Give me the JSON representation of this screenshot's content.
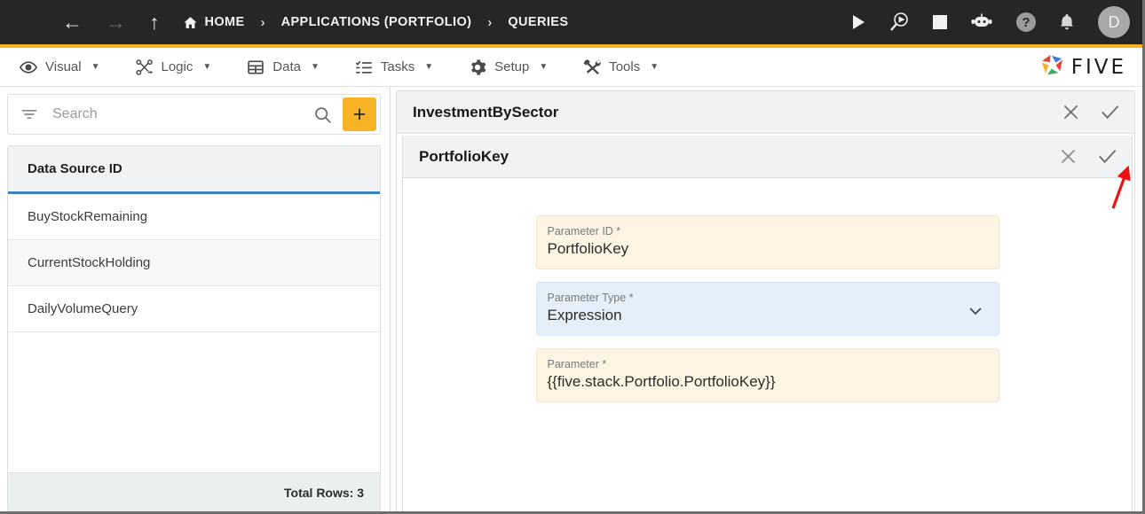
{
  "topbar": {
    "menu_icon": "hamburger-icon",
    "back_icon": "arrow-left-icon",
    "forward_icon": "arrow-right-icon",
    "up_icon": "arrow-up-icon",
    "breadcrumbs": [
      {
        "label": "HOME",
        "icon": "home-icon"
      },
      {
        "label": "APPLICATIONS (PORTFOLIO)",
        "icon": ""
      },
      {
        "label": "QUERIES",
        "icon": ""
      }
    ],
    "separator": "›",
    "actions": [
      {
        "name": "run-icon",
        "title": "Run"
      },
      {
        "name": "debug-icon",
        "title": "Debug"
      },
      {
        "name": "stop-icon",
        "title": "Stop"
      },
      {
        "name": "chatbot-icon",
        "title": "Assistant"
      },
      {
        "name": "help-icon",
        "title": "Help",
        "glyph": "?"
      },
      {
        "name": "notifications-bell-icon",
        "title": "Notifications"
      }
    ],
    "avatar_initial": "D"
  },
  "menubar": {
    "items": [
      {
        "label": "Visual",
        "icon": "eye-icon"
      },
      {
        "label": "Logic",
        "icon": "nodes-icon"
      },
      {
        "label": "Data",
        "icon": "table-icon"
      },
      {
        "label": "Tasks",
        "icon": "checklist-icon"
      },
      {
        "label": "Setup",
        "icon": "gear-icon"
      },
      {
        "label": "Tools",
        "icon": "tools-icon"
      }
    ],
    "caret": "▼",
    "brand_text": "FIVE",
    "brand_icon": "five-pinwheel-logo"
  },
  "sidebar": {
    "search": {
      "placeholder": "Search",
      "value": "",
      "filter_icon": "filter-icon",
      "search_icon": "search-icon"
    },
    "add_button_label": "+",
    "column_header": "Data Source ID",
    "rows": [
      {
        "label": "BuyStockRemaining"
      },
      {
        "label": "CurrentStockHolding"
      },
      {
        "label": "DailyVolumeQuery"
      }
    ],
    "footer": "Total Rows: 3"
  },
  "main": {
    "outer_card": {
      "title": "InvestmentBySector",
      "close_icon": "close-icon",
      "confirm_icon": "checkmark-icon"
    },
    "inner_card": {
      "title": "PortfolioKey",
      "close_icon": "close-icon",
      "confirm_icon": "checkmark-icon"
    },
    "fields": [
      {
        "label": "Parameter ID *",
        "value": "PortfolioKey",
        "style": "cream",
        "type": "text"
      },
      {
        "label": "Parameter Type *",
        "value": "Expression",
        "style": "blue",
        "type": "select"
      },
      {
        "label": "Parameter *",
        "value": "{{five.stack.Portfolio.PortfolioKey}}",
        "style": "cream",
        "type": "text"
      }
    ]
  },
  "annotation": {
    "arrow_color": "#ee1111",
    "points_to": "inner-card-confirm-icon"
  },
  "colors": {
    "accent": "#f5b325",
    "topbar_bg": "#262626",
    "select_highlight": "#e4effa",
    "required_field": "#fdf4e3",
    "header_underline": "#3b82c4"
  }
}
